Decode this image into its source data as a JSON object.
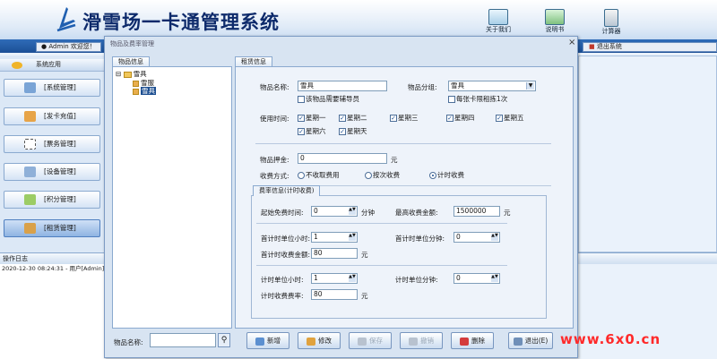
{
  "app": {
    "title": "滑雪场一卡通管理系统"
  },
  "toolbar": {
    "items": [
      {
        "label": "关于我们",
        "icon": "monitor-icon"
      },
      {
        "label": "说明书",
        "icon": "book-icon"
      },
      {
        "label": "计算器",
        "icon": "calculator-icon"
      }
    ]
  },
  "header": {
    "user_info": "Admin 欢迎您！",
    "exit_label": "退出系统"
  },
  "sidebar": {
    "header": "系统应用",
    "items": [
      {
        "label": "[系统管理]",
        "icon": "tools-icon"
      },
      {
        "label": "[发卡充值]",
        "icon": "card-icon"
      },
      {
        "label": "[票务管理]",
        "icon": "ticket-icon"
      },
      {
        "label": "[设备管理]",
        "icon": "device-icon"
      },
      {
        "label": "[积分管理]",
        "icon": "points-icon"
      },
      {
        "label": "[租赁管理]",
        "icon": "rental-icon"
      }
    ]
  },
  "log": {
    "title": "操作日志",
    "entry": "2020-12-30 08:24:31 - 用户[Admin]"
  },
  "modal": {
    "title": "物品及费率管理",
    "tree_tab": "物品信息",
    "form_tab": "租赁信息",
    "tree": {
      "root": "雪具",
      "children": [
        "雪服",
        "雪具"
      ]
    },
    "form": {
      "item_name_label": "物品名称:",
      "item_name_value": "雪具",
      "group_label": "物品分组:",
      "group_value": "雪具",
      "need_guide_label": "该物品需要辅导员",
      "limit_once_label": "每张卡限租拣1次",
      "use_time_label": "使用时间:",
      "days": [
        "星期一",
        "星期二",
        "星期三",
        "星期四",
        "星期五",
        "星期六",
        "星期天"
      ],
      "deposit_label": "物品押金:",
      "deposit_value": "0",
      "deposit_unit": "元",
      "charge_mode_label": "收费方式:",
      "charge_modes": [
        "不收取费用",
        "按次收费",
        "计时收费"
      ],
      "charge_mode_selected": "计时收费"
    },
    "fee": {
      "title": "费率信息(计时收费)",
      "free_time_label": "起始免费时间:",
      "free_time_value": "0",
      "free_time_unit": "分钟",
      "max_fee_label": "最高收费金额:",
      "max_fee_value": "1500000",
      "max_fee_unit": "元",
      "first_hours_label": "首计时单位小时:",
      "first_hours_value": "1",
      "first_minutes_label": "首计时单位分钟:",
      "first_minutes_value": "0",
      "first_amount_label": "首计时收费金额:",
      "first_amount_value": "80",
      "first_amount_unit": "元",
      "unit_hours_label": "计时单位小时:",
      "unit_hours_value": "1",
      "unit_minutes_label": "计时单位分钟:",
      "unit_minutes_value": "0",
      "unit_rate_label": "计时收费费率:",
      "unit_rate_value": "80",
      "unit_rate_unit": "元"
    },
    "search": {
      "label": "物品名称:",
      "value": ""
    },
    "buttons": {
      "new": "新增",
      "edit": "修改",
      "save": "保存",
      "cancel": "撤销",
      "delete": "删除",
      "exit": "退出(E)"
    }
  },
  "watermark": "www.6x0.cn",
  "colors": {
    "accent": "#1b4f96",
    "watermark": "#ff2a2a"
  }
}
